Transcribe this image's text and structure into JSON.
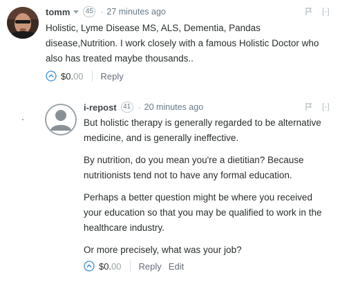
{
  "comments": [
    {
      "username": "tomm",
      "badge": "45",
      "bullet": "·",
      "timestamp": "27 minutes ago",
      "collapse": "[-]",
      "paragraphs": [
        "Holistic, Lyme Disease MS, ALS, Dementia, Pandas disease,Nutrition. I work closely with a famous Holistic Doctor who also has treated maybe thousands.."
      ],
      "tip_dollars": "$0.",
      "tip_cents": "00",
      "reply_label": "Reply"
    },
    {
      "username": "i-repost",
      "badge": "41",
      "bullet": "·",
      "timestamp": "20 minutes ago",
      "collapse": "[-]",
      "paragraphs": [
        "But holistic therapy is generally regarded to be alternative medicine, and is generally ineffective.",
        "By nutrition, do you mean you're a dietitian? Because nutritionists tend not to have any formal education.",
        "Perhaps a better question might be where you received your education so that you may be qualified to work in the healthcare industry.",
        "Or more precisely, what was your job?"
      ],
      "tip_dollars": "$0.",
      "tip_cents": "00",
      "reply_label": "Reply",
      "edit_label": "Edit"
    }
  ],
  "colors": {
    "accent_blue": "#3b8fd6",
    "muted": "#687a86"
  }
}
